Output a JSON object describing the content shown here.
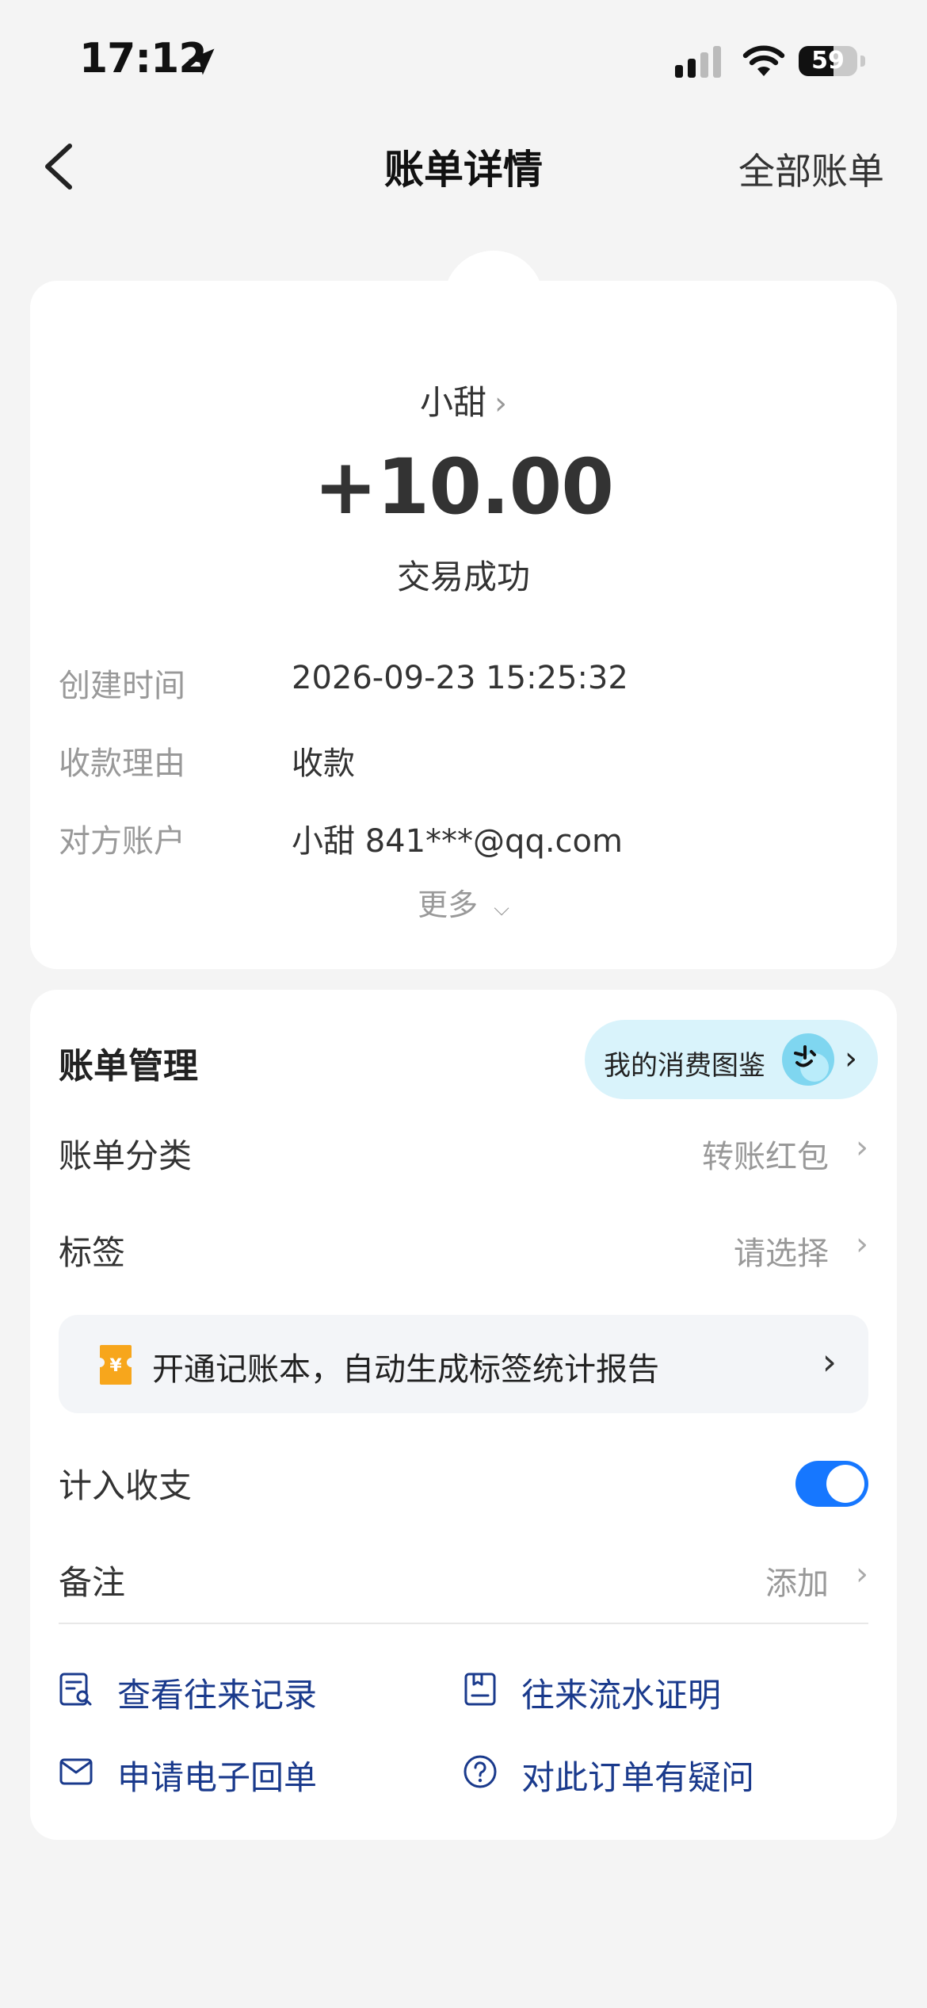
{
  "status_bar": {
    "time": "17:12",
    "battery": "59",
    "battery_level": 0.59
  },
  "nav": {
    "title": "账单详情",
    "right_link": "全部账单"
  },
  "bill": {
    "counterparty": "小甜",
    "amount": "+10.00",
    "status": "交易成功",
    "rows": [
      {
        "label": "创建时间",
        "value": "2026-09-23 15:25:32"
      },
      {
        "label": "收款理由",
        "value": "收款"
      },
      {
        "label": "对方账户",
        "value": "小甜 841***@qq.com"
      }
    ],
    "more": "更多"
  },
  "management": {
    "title": "账单管理",
    "guide_button": "我的消费图鉴",
    "category": {
      "label": "账单分类",
      "value": "转账红包"
    },
    "tag": {
      "label": "标签",
      "value": "请选择"
    },
    "promo": "开通记账本，自动生成标签统计报告",
    "count_in": {
      "label": "计入收支",
      "enabled": true
    },
    "note": {
      "label": "备注",
      "value": "添加"
    },
    "links": {
      "records": "查看往来记录",
      "statement": "往来流水证明",
      "receipt": "申请电子回单",
      "question": "对此订单有疑问"
    }
  },
  "colors": {
    "accent": "#1677ff",
    "link_text": "#1a3a8c",
    "promo_icon": "#f7a61c",
    "pill_bg": "#d9f3fb"
  }
}
